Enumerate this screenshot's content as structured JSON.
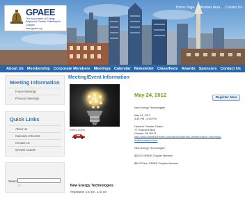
{
  "header": {
    "top_links": [
      "Home Page",
      "Member Area",
      "Contact Us"
    ],
    "logo": {
      "word": "GPAEE",
      "sub": "The Association of Energy Engineers Greater Philadelphia Chapter",
      "url": "www.gpaee.org"
    }
  },
  "nav": {
    "items": [
      "About Us",
      "Membership",
      "Corporate Members",
      "Meetings",
      "Calendar",
      "Newsletter",
      "Classifieds",
      "Awards",
      "Sponsors",
      "Contact Us"
    ]
  },
  "sidebar": {
    "meeting_info": {
      "title": "Meeting Information",
      "items": [
        "Future Meetings",
        "Previous Meetings"
      ]
    },
    "quick_links": {
      "title": "Quick Links",
      "items": [
        "About Us",
        "Calendar of Events",
        "Contact Us",
        "GPAEE Awards"
      ]
    },
    "search": {
      "label": "Search",
      "button": "GO"
    }
  },
  "main": {
    "title": "Meeting/Event Information",
    "date": "May 24, 2012",
    "register_label": "Register Now",
    "directions_label": "DIRECTIONS",
    "event": {
      "name": "New Energy Technologies",
      "date": "May 24, 2012",
      "time": "3:30 PM - 6:30 PM",
      "venue": "Harrah's Chester Casino",
      "address1": "777 Harrah's Blvd",
      "address2": "Chester, PA 19013",
      "link": "http://www.harrahschester.com/casinos/harrahs-chester/casino-miscmaps-andinformation.html",
      "name_repeat": "New Energy Technologies",
      "price_member": "$35.00 GPAEE Chapter Member",
      "price_nonmember": "$50.00 Non GPAEE Chapter Member"
    },
    "sub_title": "New Energy Technologies",
    "registration_line": "Registration 3:30 pm - 4:30 pm"
  },
  "colors": {
    "nav_bg": "#2a66a6",
    "heading_blue": "#2b74b8",
    "date_green": "#6aa121",
    "link_blue": "#1a4fb5"
  }
}
